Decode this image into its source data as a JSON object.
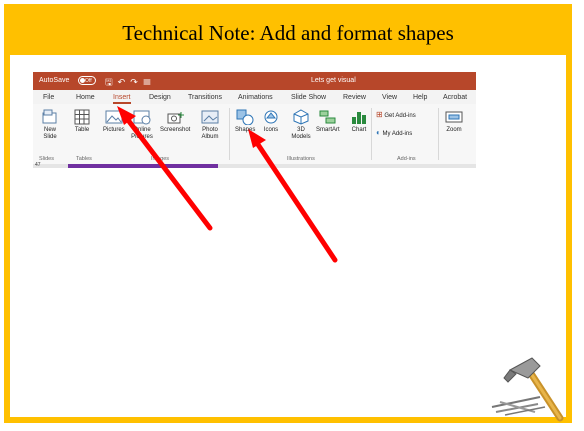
{
  "slide": {
    "title": "Technical Note: Add and format shapes"
  },
  "titlebar": {
    "autosave_label": "AutoSave",
    "toggle_state": "Off",
    "document_title": "Lets get visual",
    "accent_color": "#b7472a"
  },
  "tabs": [
    "File",
    "Home",
    "Insert",
    "Design",
    "Transitions",
    "Animations",
    "Slide Show",
    "Review",
    "View",
    "Help",
    "Acrobat"
  ],
  "active_tab": "Insert",
  "ribbon": {
    "new_slide": "New Slide",
    "table": "Table",
    "pictures": "Pictures",
    "online_pictures": "Online Pictures",
    "screenshot": "Screenshot",
    "photo_album": "Photo Album",
    "shapes": "Shapes",
    "icons": "Icons",
    "models_3d": "3D Models",
    "smartart": "SmartArt",
    "chart": "Chart",
    "get_addins": "Get Add-ins",
    "my_addins": "My Add-ins",
    "zoom": "Zoom",
    "groups": {
      "slides": "Slides",
      "tables": "Tables",
      "images": "Images",
      "illustrations": "Illustrations",
      "addins": "Add-ins"
    }
  },
  "slide_number_strip": "47",
  "icons": [
    "arrow-annotation-icon",
    "hammer-nails-icon"
  ],
  "colors": {
    "border": "#ffc000",
    "arrow": "#ff0000",
    "ribbon_accent": "#b7472a"
  }
}
